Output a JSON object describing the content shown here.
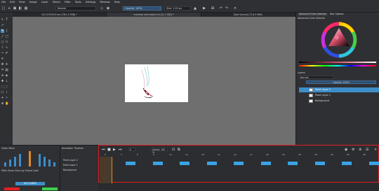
{
  "menu": [
    "File",
    "Edit",
    "View",
    "Image",
    "Layer",
    "Select",
    "Filter",
    "Tools",
    "Settings",
    "Window",
    "Help"
  ],
  "toolbar": {
    "blend_mode": "Normal",
    "opacity": "Opacity: 100%",
    "size": "Size: 1.00 px"
  },
  "tabs": [
    {
      "label": "GO-CHO923.kra [781.5 MiB] *"
    },
    {
      "label": "minimal animation.kra [2.1 GiB] *"
    },
    {
      "label": "[Not Saved] [718.3 MiB]"
    }
  ],
  "dock": {
    "color_tabs": [
      "Advanced Color Selector",
      "Tool Options"
    ],
    "color_panel_title": "Advanced Color Selector",
    "layers_title": "Layers",
    "blend": "Normal",
    "opacity": "Opacity: 100%",
    "layers": [
      {
        "name": "Paint Layer 2"
      },
      {
        "name": "Paint Layer 1"
      },
      {
        "name": "Background"
      }
    ]
  },
  "brush_panel": {
    "title": "Onion Skins",
    "filter_label": "Filter Onion Skins by Frame Color",
    "reset_label": "Set Tv(68%"
  },
  "animation_docker": {
    "title": "Animation Timeline",
    "layers": [
      {
        "name": "Paint Layer 2"
      },
      {
        "name": "Paint Layer 1"
      },
      {
        "name": "Background"
      }
    ]
  },
  "timeline": {
    "frame_field": "0",
    "speed_label": "Speed: 100 %",
    "frame_numbers": [
      "0",
      "3",
      "6",
      "9",
      "12",
      "15",
      "18",
      "21",
      "24",
      "27",
      "30",
      "33",
      "36",
      "39",
      "42",
      "45",
      "48"
    ]
  },
  "colors": {
    "accent": "#3d8ec9",
    "frame": "#3aa3e3",
    "highlight": "#e31e24"
  }
}
